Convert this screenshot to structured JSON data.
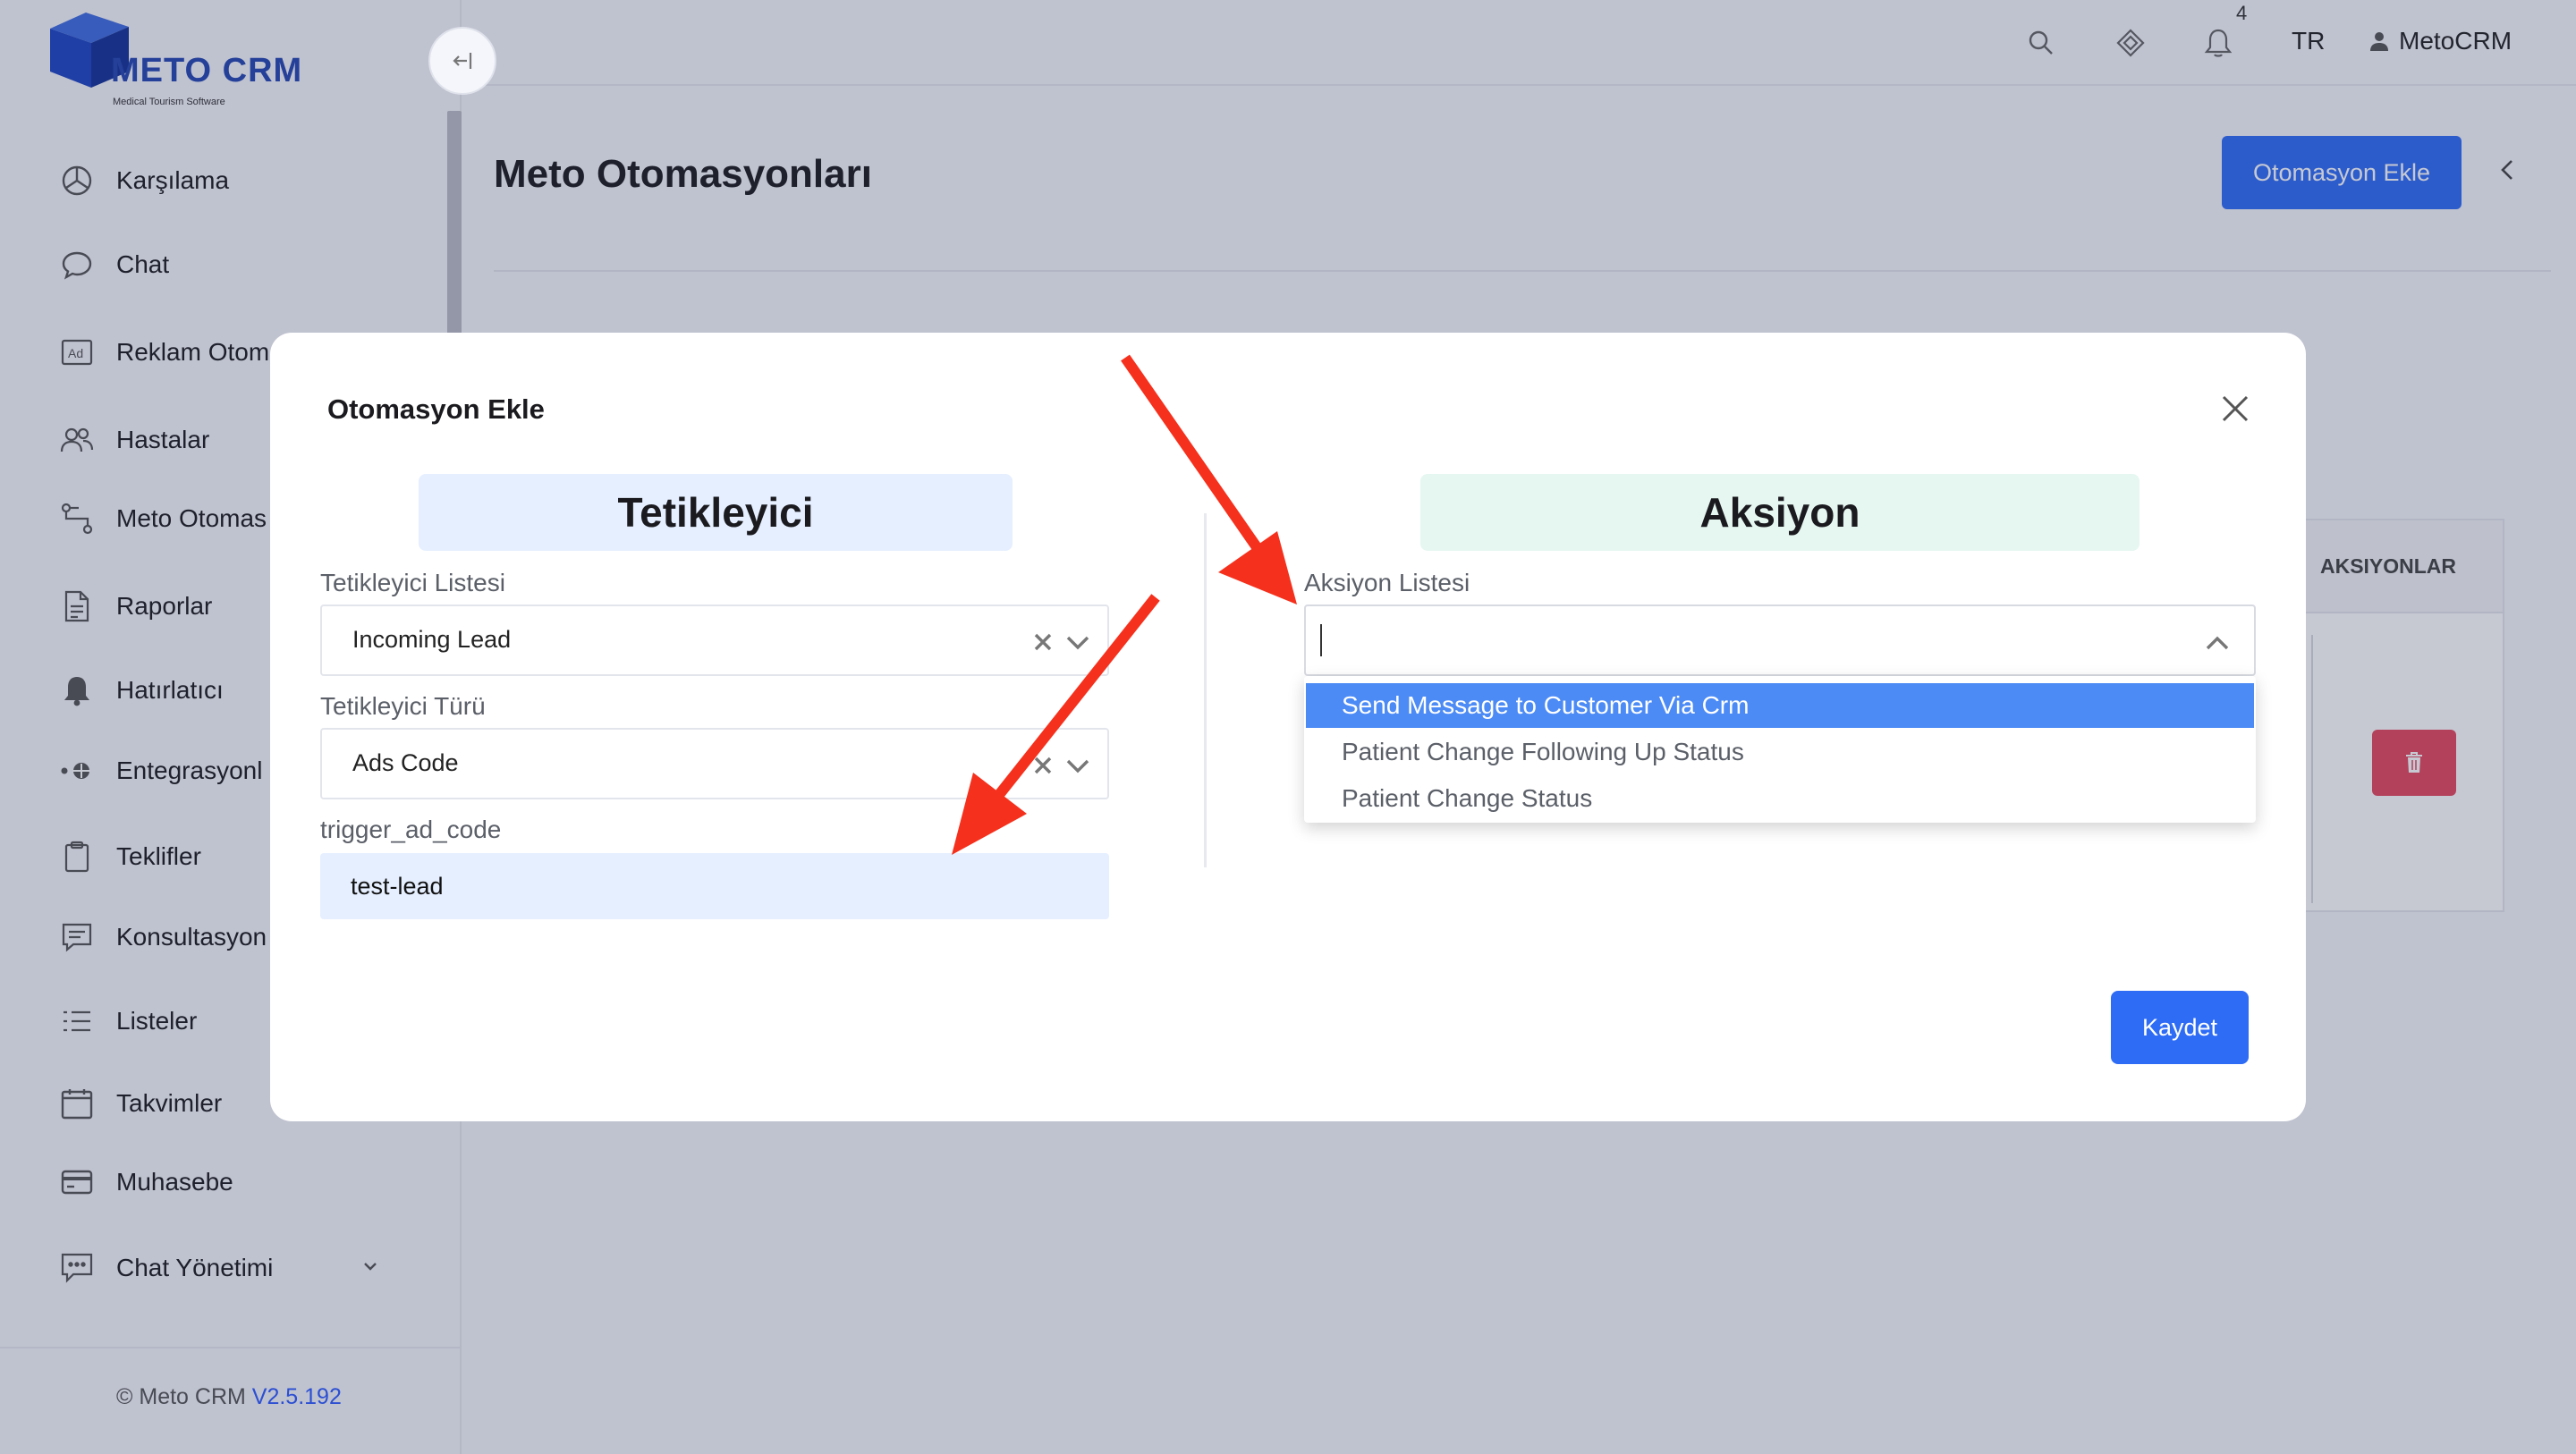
{
  "brand": {
    "name": "METO CRM",
    "tagline": "Medical Tourism Software",
    "color": "#2447b3"
  },
  "sidebar": {
    "items": [
      {
        "label": "Karşılama",
        "icon": "dashboard-icon"
      },
      {
        "label": "Chat",
        "icon": "chat-bubble-icon"
      },
      {
        "label": "Reklam Otom",
        "icon": "ad-icon"
      },
      {
        "label": "Hastalar",
        "icon": "users-icon"
      },
      {
        "label": "Meto Otomas",
        "icon": "automation-icon"
      },
      {
        "label": "Raporlar",
        "icon": "report-icon"
      },
      {
        "label": "Hatırlatıcı",
        "icon": "bell-icon"
      },
      {
        "label": "Entegrasyonl",
        "icon": "integration-icon"
      },
      {
        "label": "Teklifler",
        "icon": "clipboard-icon"
      },
      {
        "label": "Konsultasyon",
        "icon": "consultation-icon"
      },
      {
        "label": "Listeler",
        "icon": "list-icon"
      },
      {
        "label": "Takvimler",
        "icon": "calendar-icon"
      },
      {
        "label": "Muhasebe",
        "icon": "credit-card-icon"
      },
      {
        "label": "Chat Yönetimi",
        "icon": "chat-manage-icon"
      }
    ],
    "footer_prefix": "© Meto CRM",
    "version": "V2.5.192"
  },
  "header": {
    "notification_count": "4",
    "language": "TR",
    "user": "MetoCRM"
  },
  "page": {
    "title": "Meto Otomasyonları",
    "add_button": "Otomasyon Ekle",
    "table_header": "AKSIYONLAR"
  },
  "modal": {
    "title": "Otomasyon Ekle",
    "trigger": {
      "heading": "Tetikleyici",
      "list_label": "Tetikleyici Listesi",
      "list_value": "Incoming Lead",
      "type_label": "Tetikleyici Türü",
      "type_value": "Ads Code",
      "code_label": "trigger_ad_code",
      "code_value": "test-lead"
    },
    "action": {
      "heading": "Aksiyon",
      "list_label": "Aksiyon Listesi",
      "input_value": "",
      "options": [
        "Send Message to Customer Via Crm",
        "Patient Change Following Up Status",
        "Patient Change Status"
      ],
      "active_option_index": 0
    },
    "save_button": "Kaydet"
  },
  "colors": {
    "primary": "#2e6cf6",
    "danger": "#e4485f",
    "annotation_arrow": "#f5301c",
    "trigger_header_bg": "#e6efff",
    "action_header_bg": "#e6f7f1"
  }
}
